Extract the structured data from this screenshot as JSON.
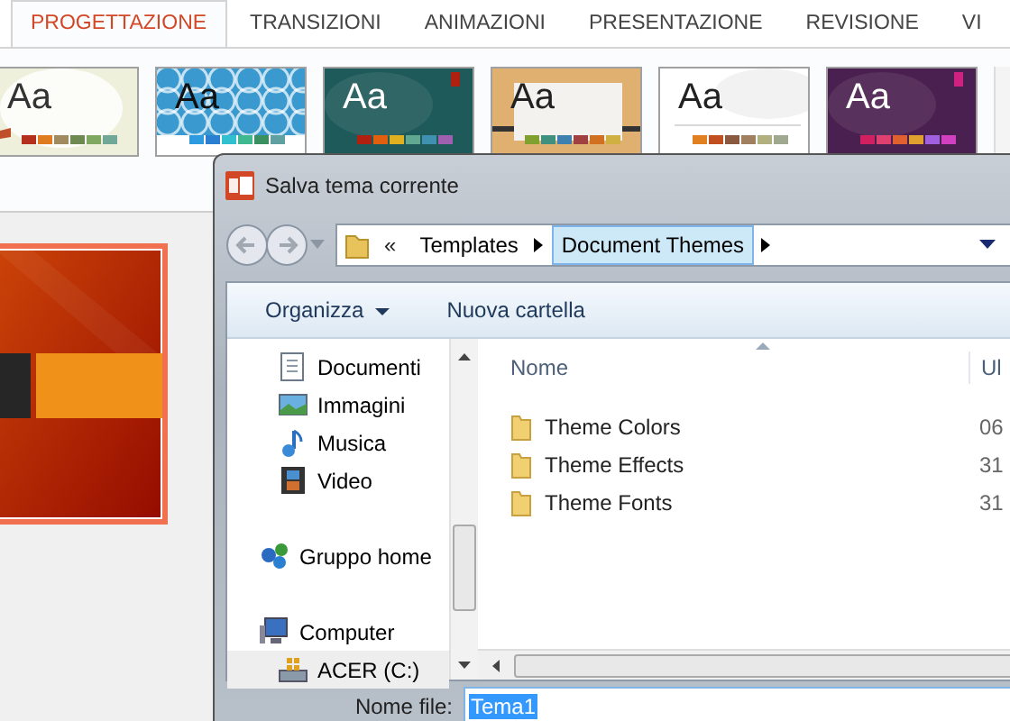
{
  "ribbon_tabs": [
    {
      "label": "PROGETTAZIONE",
      "selected": true
    },
    {
      "label": "TRANSIZIONI",
      "selected": false
    },
    {
      "label": "ANIMAZIONI",
      "selected": false
    },
    {
      "label": "PRESENTAZIONE",
      "selected": false
    },
    {
      "label": "REVISIONE",
      "selected": false
    },
    {
      "label": "VI",
      "selected": false
    }
  ],
  "themes": [
    {
      "sample": "Aa",
      "kind": "light",
      "swatches": [
        {
          "color": "#b5301c"
        },
        {
          "color": "#e07b20"
        },
        {
          "color": "#a08a60"
        },
        {
          "color": "#6e8a50"
        },
        {
          "color": "#80a860"
        },
        {
          "color": "#70a898"
        }
      ]
    },
    {
      "sample": "Aa",
      "kind": "pattern",
      "swatches": [
        {
          "color": "#2e9be0"
        },
        {
          "color": "#2a7fd0"
        },
        {
          "color": "#30c0d0"
        },
        {
          "color": "#40b890"
        },
        {
          "color": "#3a9060"
        },
        {
          "color": "#60a0a0"
        }
      ]
    },
    {
      "sample": "Aa",
      "kind": "teal",
      "swatches": [
        {
          "color": "#b02010"
        },
        {
          "color": "#e06010"
        },
        {
          "color": "#e0b020"
        },
        {
          "color": "#60a890"
        },
        {
          "color": "#4090b0"
        },
        {
          "color": "#a060b0"
        }
      ]
    },
    {
      "sample": "Aa",
      "kind": "wood",
      "swatches": [
        {
          "color": "#80a030"
        },
        {
          "color": "#409080"
        },
        {
          "color": "#4080b0"
        },
        {
          "color": "#a04040"
        },
        {
          "color": "#d07020"
        },
        {
          "color": "#d0b040"
        }
      ]
    },
    {
      "sample": "Aa",
      "kind": "plain",
      "swatches": [
        {
          "color": "#e08020"
        },
        {
          "color": "#c05020"
        },
        {
          "color": "#8a5a40"
        },
        {
          "color": "#a08060"
        },
        {
          "color": "#b0b080"
        },
        {
          "color": "#a0a890"
        }
      ]
    },
    {
      "sample": "Aa",
      "kind": "purple",
      "swatches": [
        {
          "color": "#d02060"
        },
        {
          "color": "#e04070"
        },
        {
          "color": "#e06030"
        },
        {
          "color": "#e0a030"
        },
        {
          "color": "#a060e0"
        },
        {
          "color": "#d040c0"
        }
      ]
    }
  ],
  "dialog": {
    "title": "Salva tema corrente",
    "address": {
      "overflow": "«",
      "segments": [
        {
          "label": "Templates",
          "selected": false
        },
        {
          "label": "Document Themes",
          "selected": true
        }
      ]
    },
    "toolbar": [
      {
        "label": "Organizza",
        "kind": "menu"
      },
      {
        "label": "Nuova cartella",
        "kind": "button"
      }
    ],
    "nav_pane": [
      {
        "kind": "group",
        "children": [
          {
            "label": "Documenti",
            "kind": "documents",
            "selected": false
          },
          {
            "label": "Immagini",
            "kind": "pictures",
            "selected": false
          },
          {
            "label": "Musica",
            "kind": "music",
            "selected": false
          },
          {
            "label": "Video",
            "kind": "video",
            "selected": false
          }
        ]
      },
      {
        "label": "Gruppo home",
        "kind": "homegroup",
        "selected": false
      },
      {
        "label": "Computer",
        "kind": "computer",
        "selected": false,
        "children": [
          {
            "label": "ACER (C:)",
            "kind": "drive",
            "selected": true
          }
        ]
      }
    ],
    "columns": [
      "Nome",
      "Ul"
    ],
    "files": [
      {
        "name": "Theme Colors",
        "date": "06"
      },
      {
        "name": "Theme Effects",
        "date": "31"
      },
      {
        "name": "Theme Fonts",
        "date": "31"
      }
    ],
    "file_name_label": "Nome file:",
    "file_name": "Tema1"
  }
}
